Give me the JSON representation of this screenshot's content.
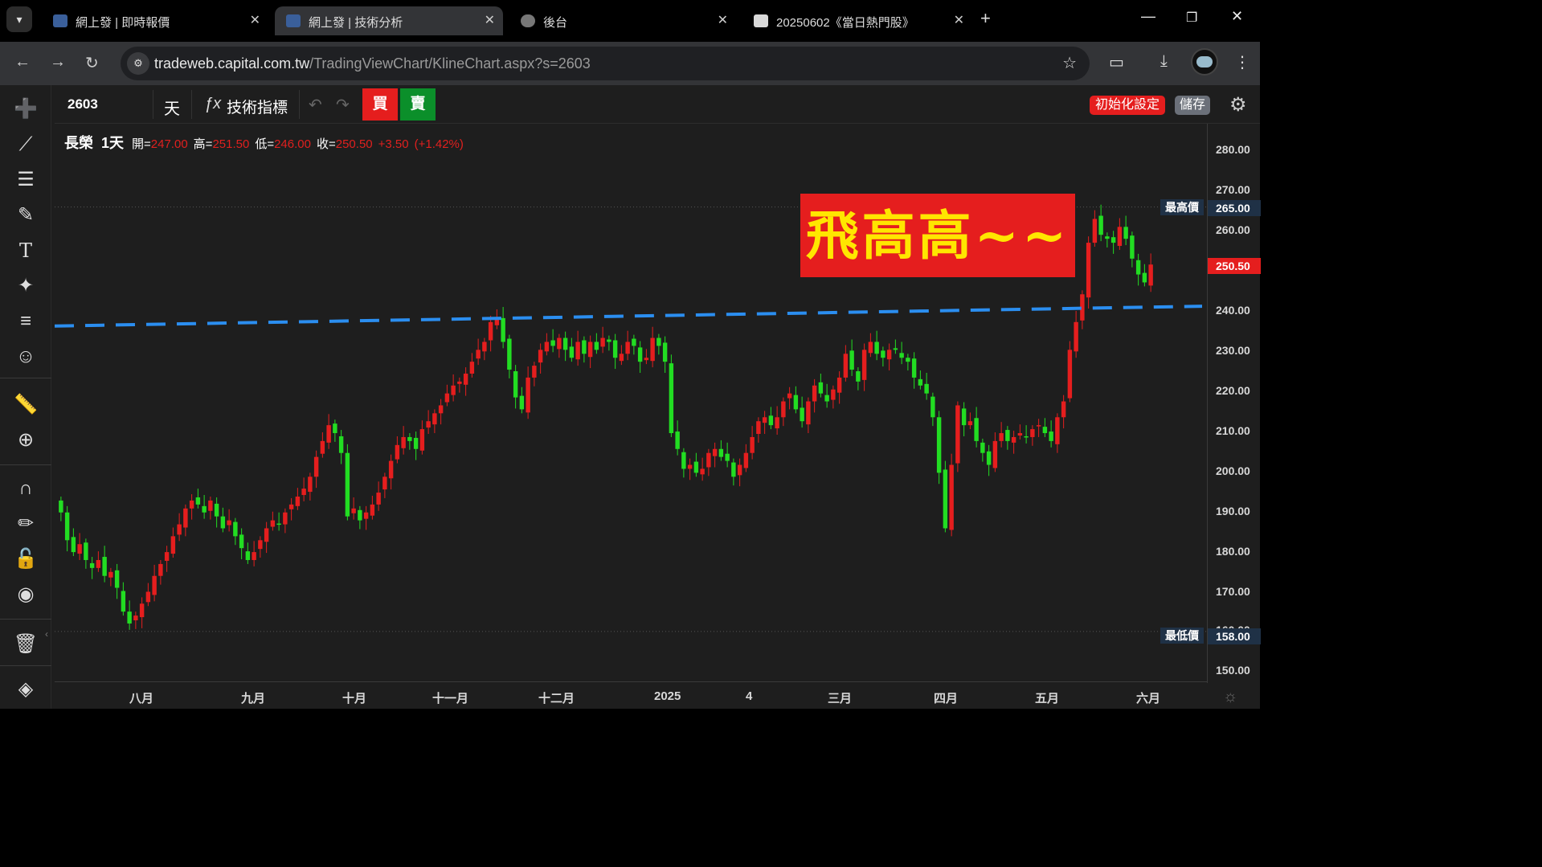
{
  "browser": {
    "tabs": [
      {
        "title": "網上發 | 即時報價"
      },
      {
        "title": "網上發 | 技術分析"
      },
      {
        "title": "後台"
      },
      {
        "title": "20250602《當日熱門股》"
      }
    ],
    "url_host": "tradeweb.capital.com.tw",
    "url_path": "/TradingViewChart/KlineChart.aspx?s=2603"
  },
  "topbar": {
    "symbol": "2603",
    "interval": "天",
    "indicators_label": "技術指標",
    "buy_label": "買",
    "sell_label": "賣",
    "reset_label": "初始化設定",
    "save_label": "儲存"
  },
  "legend": {
    "name": "長榮",
    "interval": "1天",
    "open_label": "開=",
    "open": "247.00",
    "high_label": "高=",
    "high": "251.50",
    "low_label": "低=",
    "low": "246.00",
    "close_label": "收=",
    "close": "250.50",
    "change": "+3.50",
    "change_pct": "(+1.42%)"
  },
  "banner_text": "飛高高~~",
  "price_axis": {
    "ticks": [
      "280.00",
      "270.00",
      "260.00",
      "250.00",
      "240.00",
      "230.00",
      "220.00",
      "210.00",
      "200.00",
      "190.00",
      "180.00",
      "170.00",
      "160.00",
      "150.00"
    ],
    "highest_label": "最高價",
    "highest_value": "265.00",
    "lowest_label": "最低價",
    "lowest_value": "158.00",
    "last_value": "250.50"
  },
  "time_axis": {
    "labels": [
      "八月",
      "九月",
      "十月",
      "十一月",
      "十二月",
      "2025",
      "4",
      "三月",
      "四月",
      "五月",
      "六月"
    ]
  },
  "chart_data": {
    "type": "candlestick",
    "ylim": [
      145,
      286
    ],
    "up_color": "#e51e1e",
    "down_color": "#22dd22",
    "trendline_color": "#2b8ef0",
    "trendline": [
      235,
      240
    ],
    "highest": 265,
    "lowest": 158,
    "last": 250.5,
    "closes": [
      188,
      181,
      178,
      180,
      176,
      174,
      176,
      172,
      173,
      169,
      163,
      160,
      162,
      165,
      168,
      172,
      175,
      178,
      182,
      185,
      189,
      191,
      190,
      188,
      191,
      187,
      184,
      186,
      182,
      179,
      176,
      178,
      181,
      184,
      186,
      185,
      188,
      190,
      192,
      194,
      197,
      202,
      206,
      210,
      208,
      203,
      187,
      189,
      186,
      188,
      190,
      193,
      197,
      201,
      205,
      207,
      206,
      204,
      209,
      211,
      213,
      215,
      218,
      220,
      221,
      223,
      226,
      229,
      231,
      236,
      237,
      231,
      224,
      217,
      214,
      222,
      225,
      229,
      231,
      230,
      232,
      229,
      227,
      231,
      228,
      231,
      229,
      232,
      231,
      227,
      228,
      231,
      230,
      226,
      227,
      232,
      230,
      226,
      208,
      204,
      199,
      200,
      198,
      199,
      203,
      204,
      202,
      201,
      197,
      200,
      203,
      207,
      211,
      212,
      210,
      212,
      216,
      218,
      214,
      211,
      216,
      220,
      218,
      216,
      219,
      222,
      228,
      224,
      221,
      229,
      231,
      228,
      227,
      229,
      229,
      227,
      226,
      222,
      220,
      218,
      212,
      198,
      184,
      200,
      215,
      210,
      211,
      206,
      203,
      200,
      206,
      208,
      206,
      207,
      208,
      207,
      209,
      210,
      208,
      206,
      212,
      216,
      229,
      236,
      243,
      256,
      262,
      258,
      257,
      256,
      260,
      257,
      252,
      248,
      246,
      250.5
    ]
  }
}
